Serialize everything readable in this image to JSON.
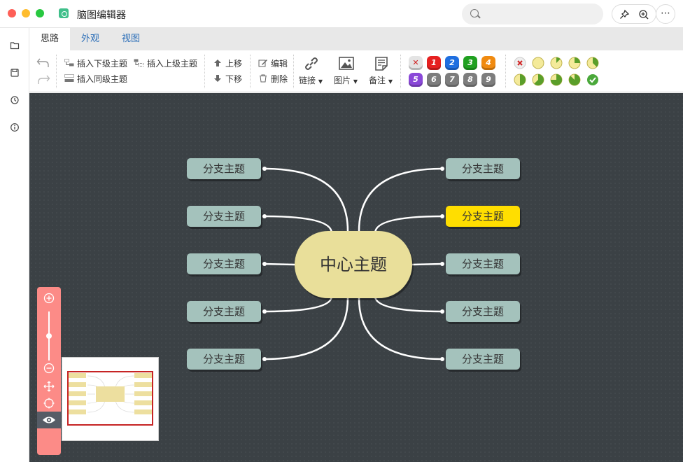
{
  "app": {
    "title": "脑图编辑器"
  },
  "titlebar": {
    "search_placeholder": "",
    "icons": [
      "pin-icon",
      "zoom-in-icon",
      "more-icon"
    ]
  },
  "sidebar": {
    "icons": [
      "folder-icon",
      "save-icon",
      "history-icon",
      "info-icon"
    ]
  },
  "tabs": [
    {
      "label": "思路",
      "active": true
    },
    {
      "label": "外观",
      "active": false
    },
    {
      "label": "视图",
      "active": false
    }
  ],
  "ribbon": {
    "insert_child": "插入下级主题",
    "insert_parent": "插入上级主题",
    "insert_sibling": "插入同级主题",
    "move_up": "上移",
    "move_down": "下移",
    "edit": "编辑",
    "delete": "删除",
    "link": "链接",
    "image": "图片",
    "note": "备注",
    "priority_labels": [
      "1",
      "2",
      "3",
      "4",
      "5",
      "6",
      "7",
      "8",
      "9"
    ],
    "priority_colors": [
      "#e62020",
      "#1f6fe0",
      "#20a020",
      "#f08a10",
      "#8a48d8",
      "#7d7d7d",
      "#7d7d7d",
      "#7d7d7d",
      "#7d7d7d"
    ],
    "progress_levels": [
      "clear",
      0,
      0.125,
      0.25,
      0.375,
      0.5,
      0.625,
      0.75,
      0.875,
      1
    ]
  },
  "mindmap": {
    "center": {
      "label": "中心主题",
      "color": "#e9df9a"
    },
    "left_branches": [
      "分支主题",
      "分支主题",
      "分支主题",
      "分支主题",
      "分支主题"
    ],
    "right_branches": [
      "分支主题",
      "分支主题",
      "分支主题",
      "分支主题",
      "分支主题"
    ],
    "selected_branch": "right-1",
    "branch_color": "#a4c2bc",
    "selected_color": "#ffde00",
    "canvas_color": "#3b4145"
  },
  "zoom_panel": {
    "color": "#fc8b87",
    "zoom_level": 0.55
  }
}
